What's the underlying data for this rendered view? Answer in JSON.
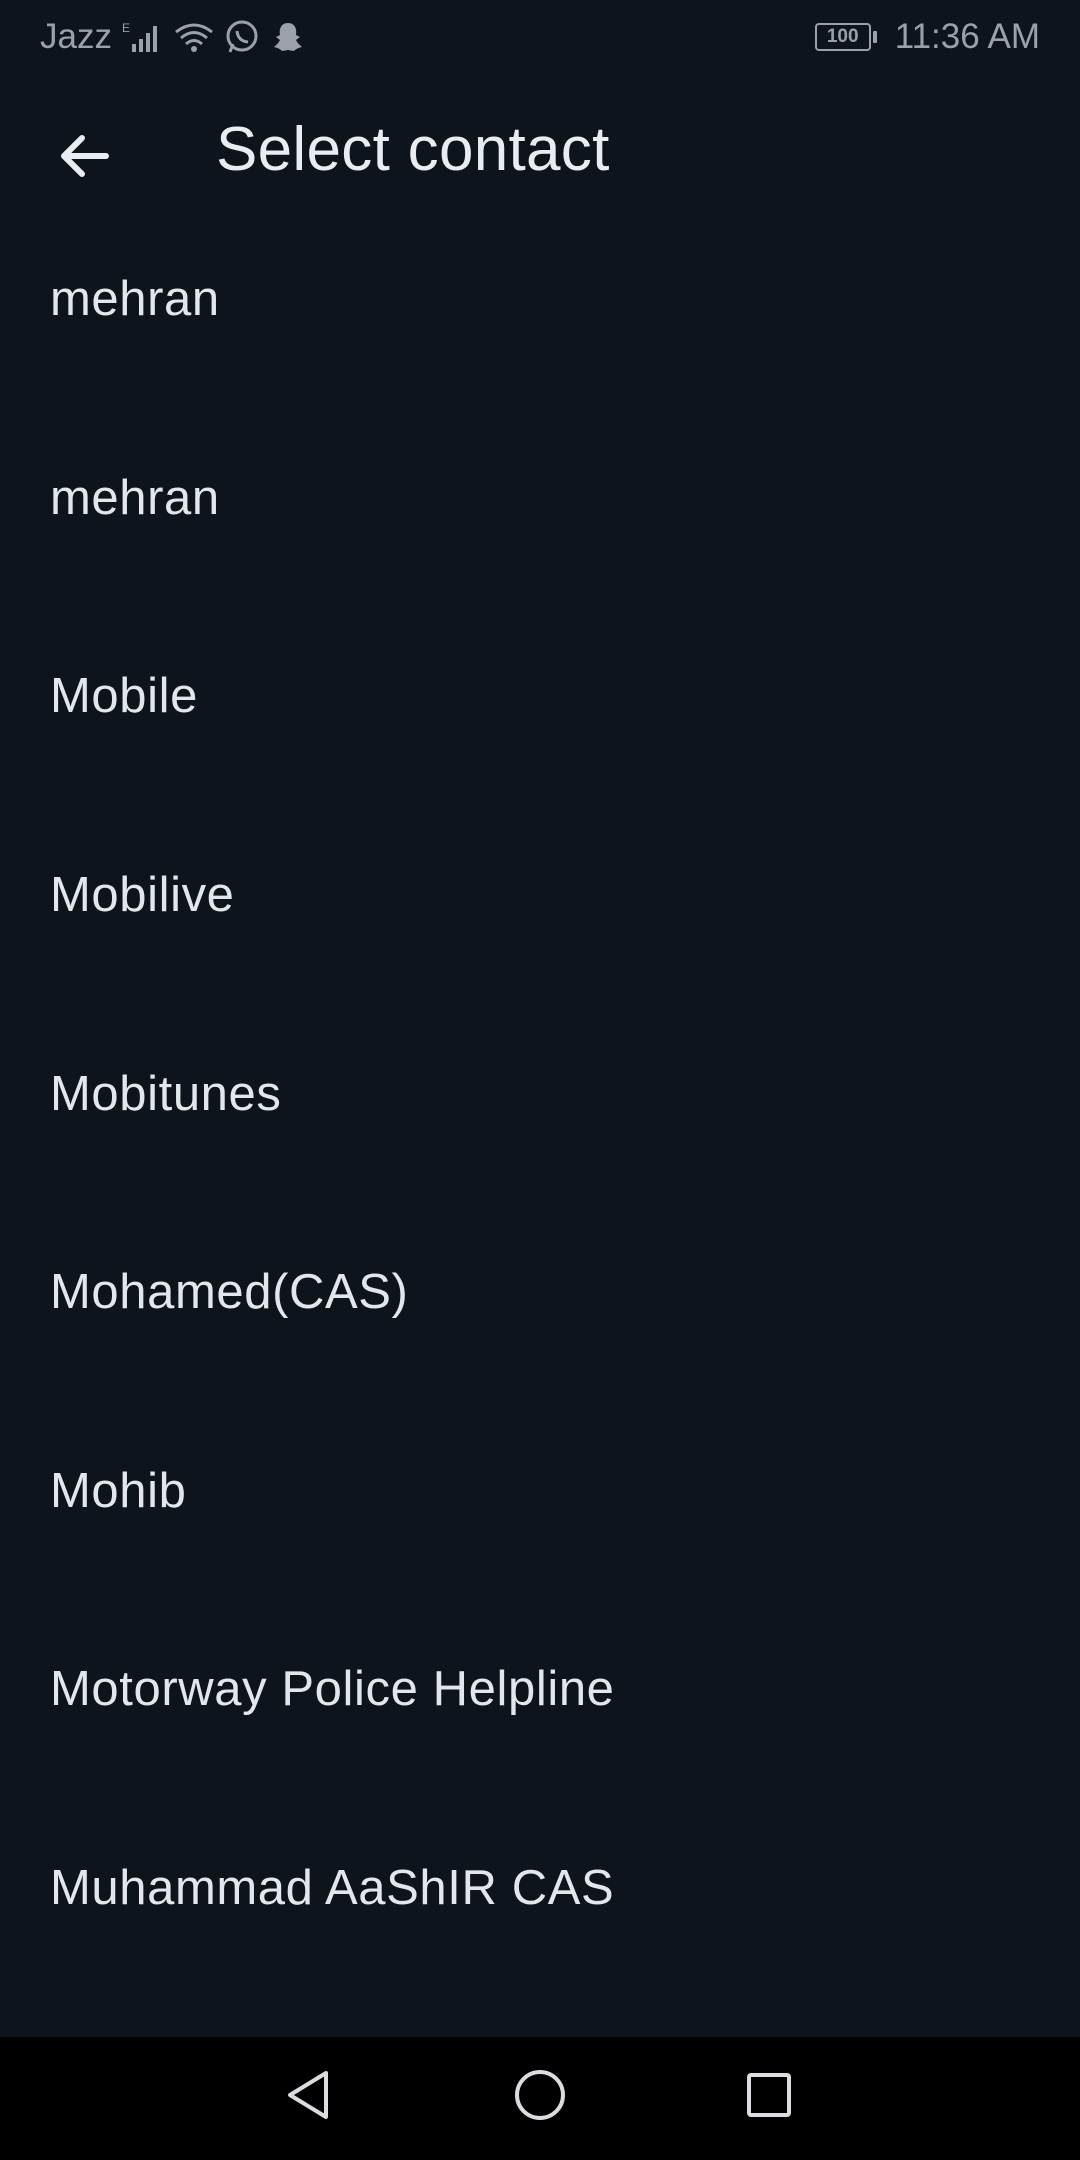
{
  "status_bar": {
    "carrier": "Jazz",
    "battery": "100",
    "time": "11:36 AM"
  },
  "app_bar": {
    "title": "Select contact"
  },
  "contacts": [
    "mehran",
    "mehran",
    "Mobile",
    "Mobilive",
    "Mobitunes",
    "Mohamed(CAS)",
    "Mohib",
    "Motorway Police Helpline",
    "Muhammad AaShIR CAS"
  ],
  "colors": {
    "background": "#0e141b",
    "nav_background": "#000000",
    "primary_text": "#e3e6ea",
    "status_text": "#9aa1aa"
  },
  "icons": {
    "back": "arrow-left-icon",
    "nav_back": "triangle-back-icon",
    "nav_home": "circle-home-icon",
    "nav_recents": "square-recents-icon"
  }
}
